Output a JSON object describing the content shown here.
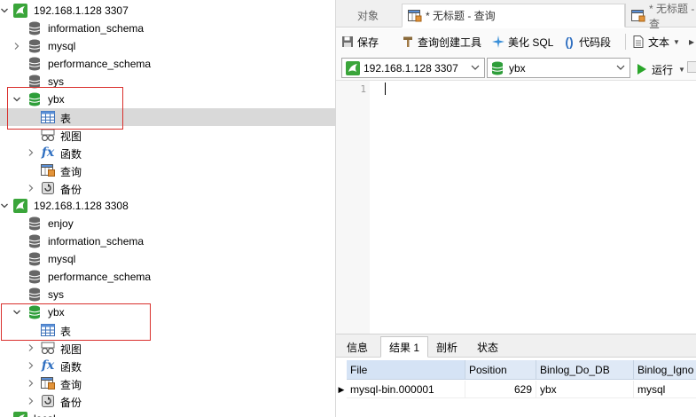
{
  "tree": {
    "rows": [
      {
        "label": "192.168.1.128 3307",
        "type": "conn",
        "expanded": true
      },
      {
        "label": "information_schema",
        "type": "db"
      },
      {
        "label": "mysql",
        "type": "db",
        "arrow": "right"
      },
      {
        "label": "performance_schema",
        "type": "db"
      },
      {
        "label": "sys",
        "type": "db"
      },
      {
        "label": "ybx",
        "type": "db-open",
        "expanded": true
      },
      {
        "label": "表",
        "type": "table",
        "selected": true
      },
      {
        "label": "视图",
        "type": "view"
      },
      {
        "label": "函数",
        "type": "func",
        "arrow": "right"
      },
      {
        "label": "查询",
        "type": "query"
      },
      {
        "label": "备份",
        "type": "backup",
        "arrow": "right"
      },
      {
        "label": "192.168.1.128 3308",
        "type": "conn",
        "expanded": true
      },
      {
        "label": "enjoy",
        "type": "db"
      },
      {
        "label": "information_schema",
        "type": "db"
      },
      {
        "label": "mysql",
        "type": "db"
      },
      {
        "label": "performance_schema",
        "type": "db"
      },
      {
        "label": "sys",
        "type": "db"
      },
      {
        "label": "ybx",
        "type": "db-open",
        "expanded": true
      },
      {
        "label": "表",
        "type": "table"
      },
      {
        "label": "视图",
        "type": "view",
        "arrow": "right"
      },
      {
        "label": "函数",
        "type": "func",
        "arrow": "right"
      },
      {
        "label": "查询",
        "type": "query",
        "arrow": "right"
      },
      {
        "label": "备份",
        "type": "backup",
        "arrow": "right"
      },
      {
        "label": "local",
        "type": "conn"
      }
    ]
  },
  "tabs": {
    "objects": "对象",
    "active": "* 无标题 - 查询",
    "second": "* 无标题 - 查"
  },
  "toolbar": {
    "save": "保存",
    "query_builder": "查询创建工具",
    "beautify": "美化 SQL",
    "snippet": "代码段",
    "text": "文本"
  },
  "connbar": {
    "connection": "192.168.1.128 3307",
    "database": "ybx",
    "run": "运行"
  },
  "editor": {
    "line_number": "1",
    "content": ""
  },
  "result_tabs": [
    "信息",
    "结果 1",
    "剖析",
    "状态"
  ],
  "grid": {
    "columns": [
      "File",
      "Position",
      "Binlog_Do_DB",
      "Binlog_Igno"
    ],
    "rows": [
      [
        "mysql-bin.000001",
        "629",
        "ybx",
        "mysql"
      ]
    ]
  },
  "colors": {
    "connection_green": "#3aa53a",
    "db_green": "#2e9e3a",
    "db_grey": "#666666",
    "highlight_box": "#d9302d",
    "run_green": "#2aa52a"
  }
}
